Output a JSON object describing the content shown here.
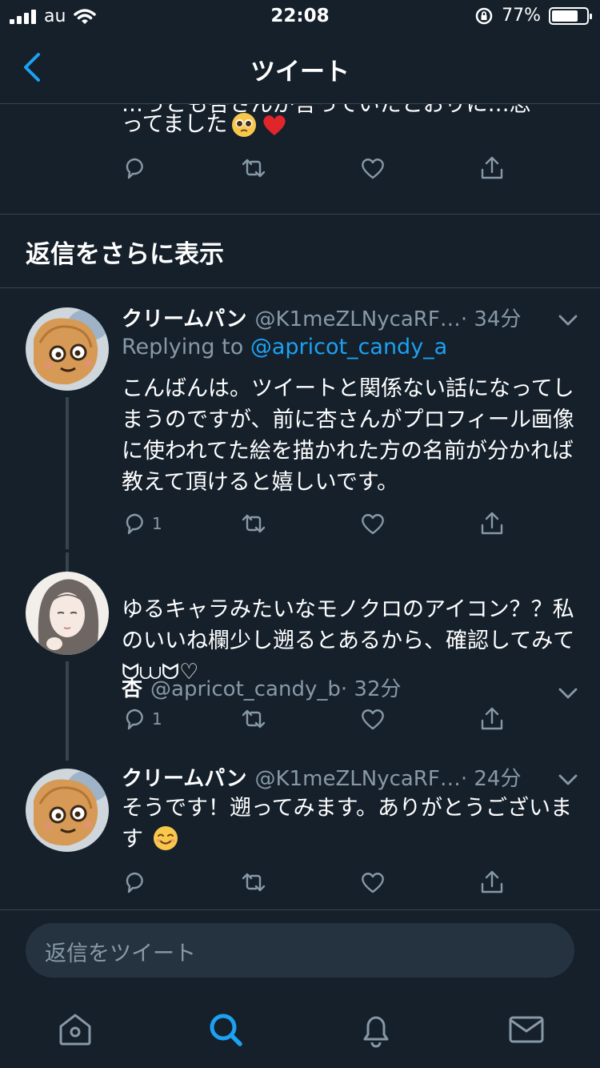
{
  "status_bar": {
    "carrier": "au",
    "time": "22:08",
    "battery": "77%",
    "battery_level": 0.77
  },
  "nav": {
    "title": "ツイート",
    "back_icon": "chevron-left-icon"
  },
  "prev_tweet": {
    "cut_text": "…っとも杏さんが言っていたとおりに…思",
    "text": "ってました"
  },
  "show_more": "返信をさらに表示",
  "tweets": [
    {
      "name": "クリームパン",
      "handle": "@K1meZLNycaRF…",
      "time": "· 34分",
      "reply_label": "Replying to",
      "reply_to": "@apricot_candy_a",
      "text": "こんばんは。ツイートと関係ない話になってしまうのですが、前に杏さんがプロフィール画像に使われてた絵を描かれた方の名前が分かれば教えて頂けると嬉しいです。",
      "reply_count": "1"
    },
    {
      "name": "杏",
      "handle": "@apricot_candy_b",
      "time": "· 32分",
      "text": "ゆるキャラみたいなモノクロのアイコン？？私のいいね欄少し遡るとあるから、確認してみて ᗢ⩊ᗢ♡",
      "reply_count": "1"
    },
    {
      "name": "クリームパン",
      "handle": "@K1meZLNycaRF…",
      "time": "· 24分",
      "text": "そうです！遡ってみます。ありがとうございます",
      "reply_count": ""
    }
  ],
  "reply_bar": {
    "placeholder": "返信をツイート"
  },
  "colors": {
    "background": "#15202b",
    "divider": "#38444d",
    "accent": "#1da1f2",
    "muted": "#8899a6"
  },
  "tabs": [
    "home-icon",
    "search-icon",
    "notifications-icon",
    "messages-icon"
  ]
}
